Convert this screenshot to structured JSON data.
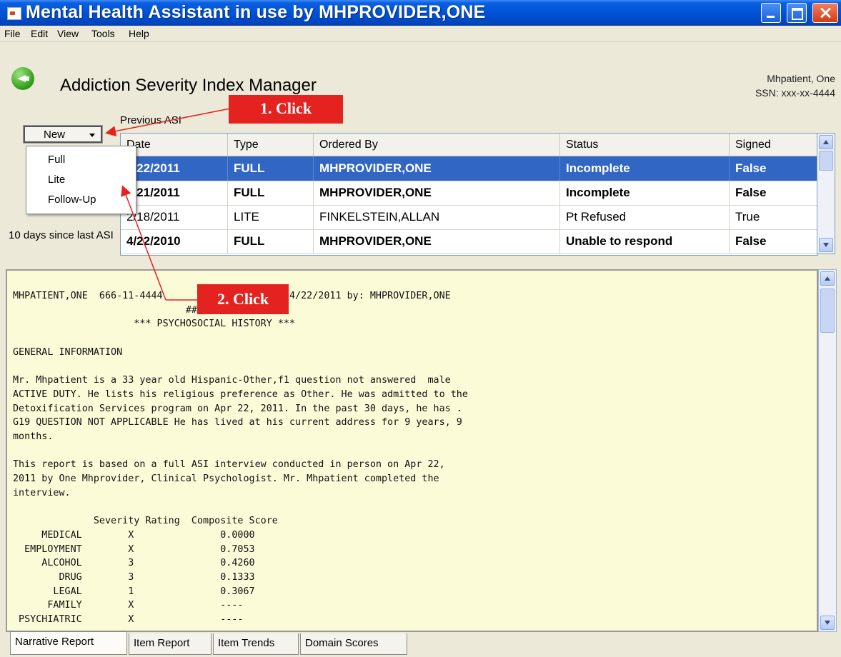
{
  "window": {
    "title": "Mental Health Assistant in use by MHPROVIDER,ONE"
  },
  "menu": {
    "file": "File",
    "edit": "Edit",
    "view": "View",
    "tools": "Tools",
    "help": "Help"
  },
  "header": {
    "title": "Addiction Severity Index Manager",
    "patient_name": "Mhpatient, One",
    "patient_ssn": "SSN: xxx-xx-4444"
  },
  "new_button": {
    "label": "New",
    "options": [
      "Full",
      "Lite",
      "Follow-Up"
    ]
  },
  "previous_asi_label": "Previous ASI",
  "days_since": "10 days since last ASI",
  "asi_table": {
    "columns": [
      "Date",
      "Type",
      "Ordered By",
      "Status",
      "Signed"
    ],
    "rows": [
      {
        "date": "4/22/2011",
        "type": "FULL",
        "ordered_by": "MHPROVIDER,ONE",
        "status": "Incomplete",
        "signed": "False",
        "bold": true,
        "selected": true
      },
      {
        "date": "4/21/2011",
        "type": "FULL",
        "ordered_by": "MHPROVIDER,ONE",
        "status": "Incomplete",
        "signed": "False",
        "bold": true,
        "selected": false
      },
      {
        "date": "2/18/2011",
        "type": "LITE",
        "ordered_by": "FINKELSTEIN,ALLAN",
        "status": "Pt Refused",
        "signed": "True",
        "bold": false,
        "selected": false
      },
      {
        "date": "4/22/2010",
        "type": "FULL",
        "ordered_by": "MHPROVIDER,ONE",
        "status": "Unable to respond",
        "signed": "False",
        "bold": true,
        "selected": false
      }
    ]
  },
  "report": {
    "lines": [
      "MHPATIENT,ONE  666-11-4444       ASI: FULL  on 04/22/2011 by: MHPROVIDER,ONE",
      "                              ##### Draft #####",
      "                     *** PSYCHOSOCIAL HISTORY ***",
      "",
      "GENERAL INFORMATION",
      "",
      "Mr. Mhpatient is a 33 year old Hispanic-Other,f1 question not answered  male",
      "ACTIVE DUTY. He lists his religious preference as Other. He was admitted to the",
      "Detoxification Services program on Apr 22, 2011. In the past 30 days, he has .",
      "G19 QUESTION NOT APPLICABLE He has lived at his current address for 9 years, 9",
      "months.",
      "",
      "This report is based on a full ASI interview conducted in person on Apr 22,",
      "2011 by One Mhprovider, Clinical Psychologist. Mr. Mhpatient completed the",
      "interview.",
      "",
      "              Severity Rating  Composite Score",
      "     MEDICAL        X               0.0000",
      "  EMPLOYMENT        X               0.7053",
      "     ALCOHOL        3               0.4260",
      "        DRUG        3               0.1333",
      "       LEGAL        1               0.3067",
      "      FAMILY        X               ----",
      " PSYCHIATRIC        X               ----"
    ]
  },
  "tabs": [
    "Narrative Report",
    "Item Report",
    "Item Trends",
    "Domain Scores"
  ],
  "callouts": {
    "step1": "1. Click",
    "step2": "2. Click"
  },
  "colors": {
    "selection": "#3166c5",
    "report_bg": "#fcfbd8",
    "callout": "#e42220",
    "titlebar": "#0053d6"
  }
}
